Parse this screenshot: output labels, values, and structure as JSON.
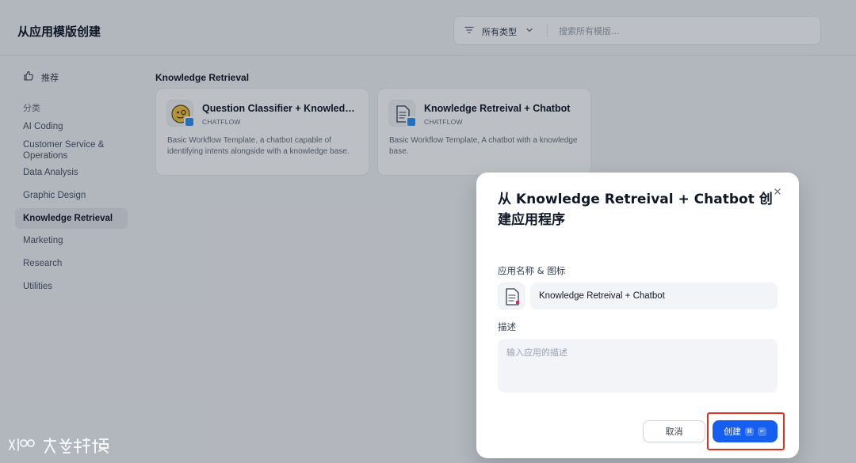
{
  "page": {
    "title": "从应用模版创建",
    "filter": {
      "label": "所有类型"
    },
    "search": {
      "placeholder": "搜索所有模版..."
    }
  },
  "sidebar": {
    "recommended": "推荐",
    "section_label": "分类",
    "items": [
      {
        "label": "AI Coding"
      },
      {
        "label": "Customer Service & Operations"
      },
      {
        "label": "Data Analysis"
      },
      {
        "label": "Graphic Design"
      },
      {
        "label": "Knowledge Retrieval",
        "active": true
      },
      {
        "label": "Marketing"
      },
      {
        "label": "Research"
      },
      {
        "label": "Utilities"
      }
    ]
  },
  "main": {
    "category_title": "Knowledge Retrieval",
    "cards": [
      {
        "name": "Question Classifier + Knowledge Base + Chatbot",
        "type": "CHATFLOW",
        "description": "Basic Workflow Template, a chatbot capable of identifying intents alongside with a knowledge base.",
        "icon": "emoji-face-icon"
      },
      {
        "name": "Knowledge Retreival + Chatbot",
        "type": "CHATFLOW",
        "description": "Basic Workflow Template, A chatbot with a knowledge base.",
        "icon": "document-icon"
      }
    ]
  },
  "modal": {
    "title": "从 Knowledge Retreival + Chatbot 创建应用程序",
    "name_label": "应用名称 & 图标",
    "name_value": "Knowledge Retreival + Chatbot",
    "desc_label": "描述",
    "desc_placeholder": "输入应用的描述",
    "cancel_label": "取消",
    "create_label": "创建",
    "shortcut_keys": [
      "⌘",
      "↵"
    ]
  },
  "colors": {
    "primary": "#155eef",
    "highlight_border": "#e0301e",
    "chatflow_badge": "#2e90fa",
    "overlay": "rgba(16,24,40,0.28)"
  },
  "watermark": {
    "text": "大数跨境"
  }
}
